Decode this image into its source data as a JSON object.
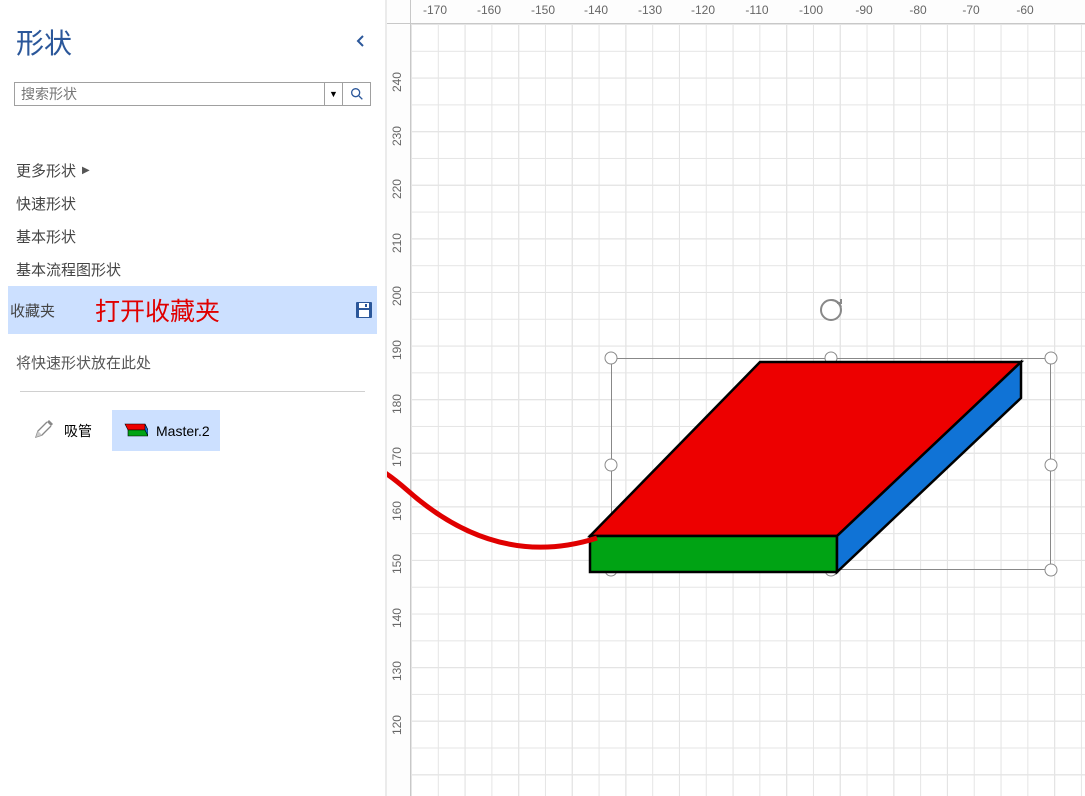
{
  "sidebar": {
    "title": "形状",
    "search": {
      "placeholder": "搜索形状"
    },
    "categories": [
      {
        "label": "更多形状",
        "has_arrow": true
      },
      {
        "label": "快速形状"
      },
      {
        "label": "基本形状"
      },
      {
        "label": "基本流程图形状"
      },
      {
        "label": "收藏夹",
        "selected": true,
        "annotation": "打开收藏夹",
        "has_save": true
      }
    ],
    "quick_hint": "将快速形状放在此处",
    "shapes": [
      {
        "name": "eyedropper",
        "label": "吸管"
      },
      {
        "name": "master2",
        "label": "Master.2",
        "selected": true
      }
    ]
  },
  "ruler": {
    "h": [
      "-170",
      "-160",
      "-150",
      "-140",
      "-130",
      "-120",
      "-110",
      "-100",
      "-90",
      "-80",
      "-70",
      "-60"
    ],
    "v": [
      "240",
      "230",
      "220",
      "210",
      "200",
      "190",
      "180",
      "170",
      "160",
      "150",
      "140",
      "130",
      "120"
    ]
  },
  "canvas": {
    "shape": {
      "top_color": "#ed0000",
      "front_color": "#00a314",
      "side_color": "#1073d6",
      "stroke": "#000000"
    }
  }
}
